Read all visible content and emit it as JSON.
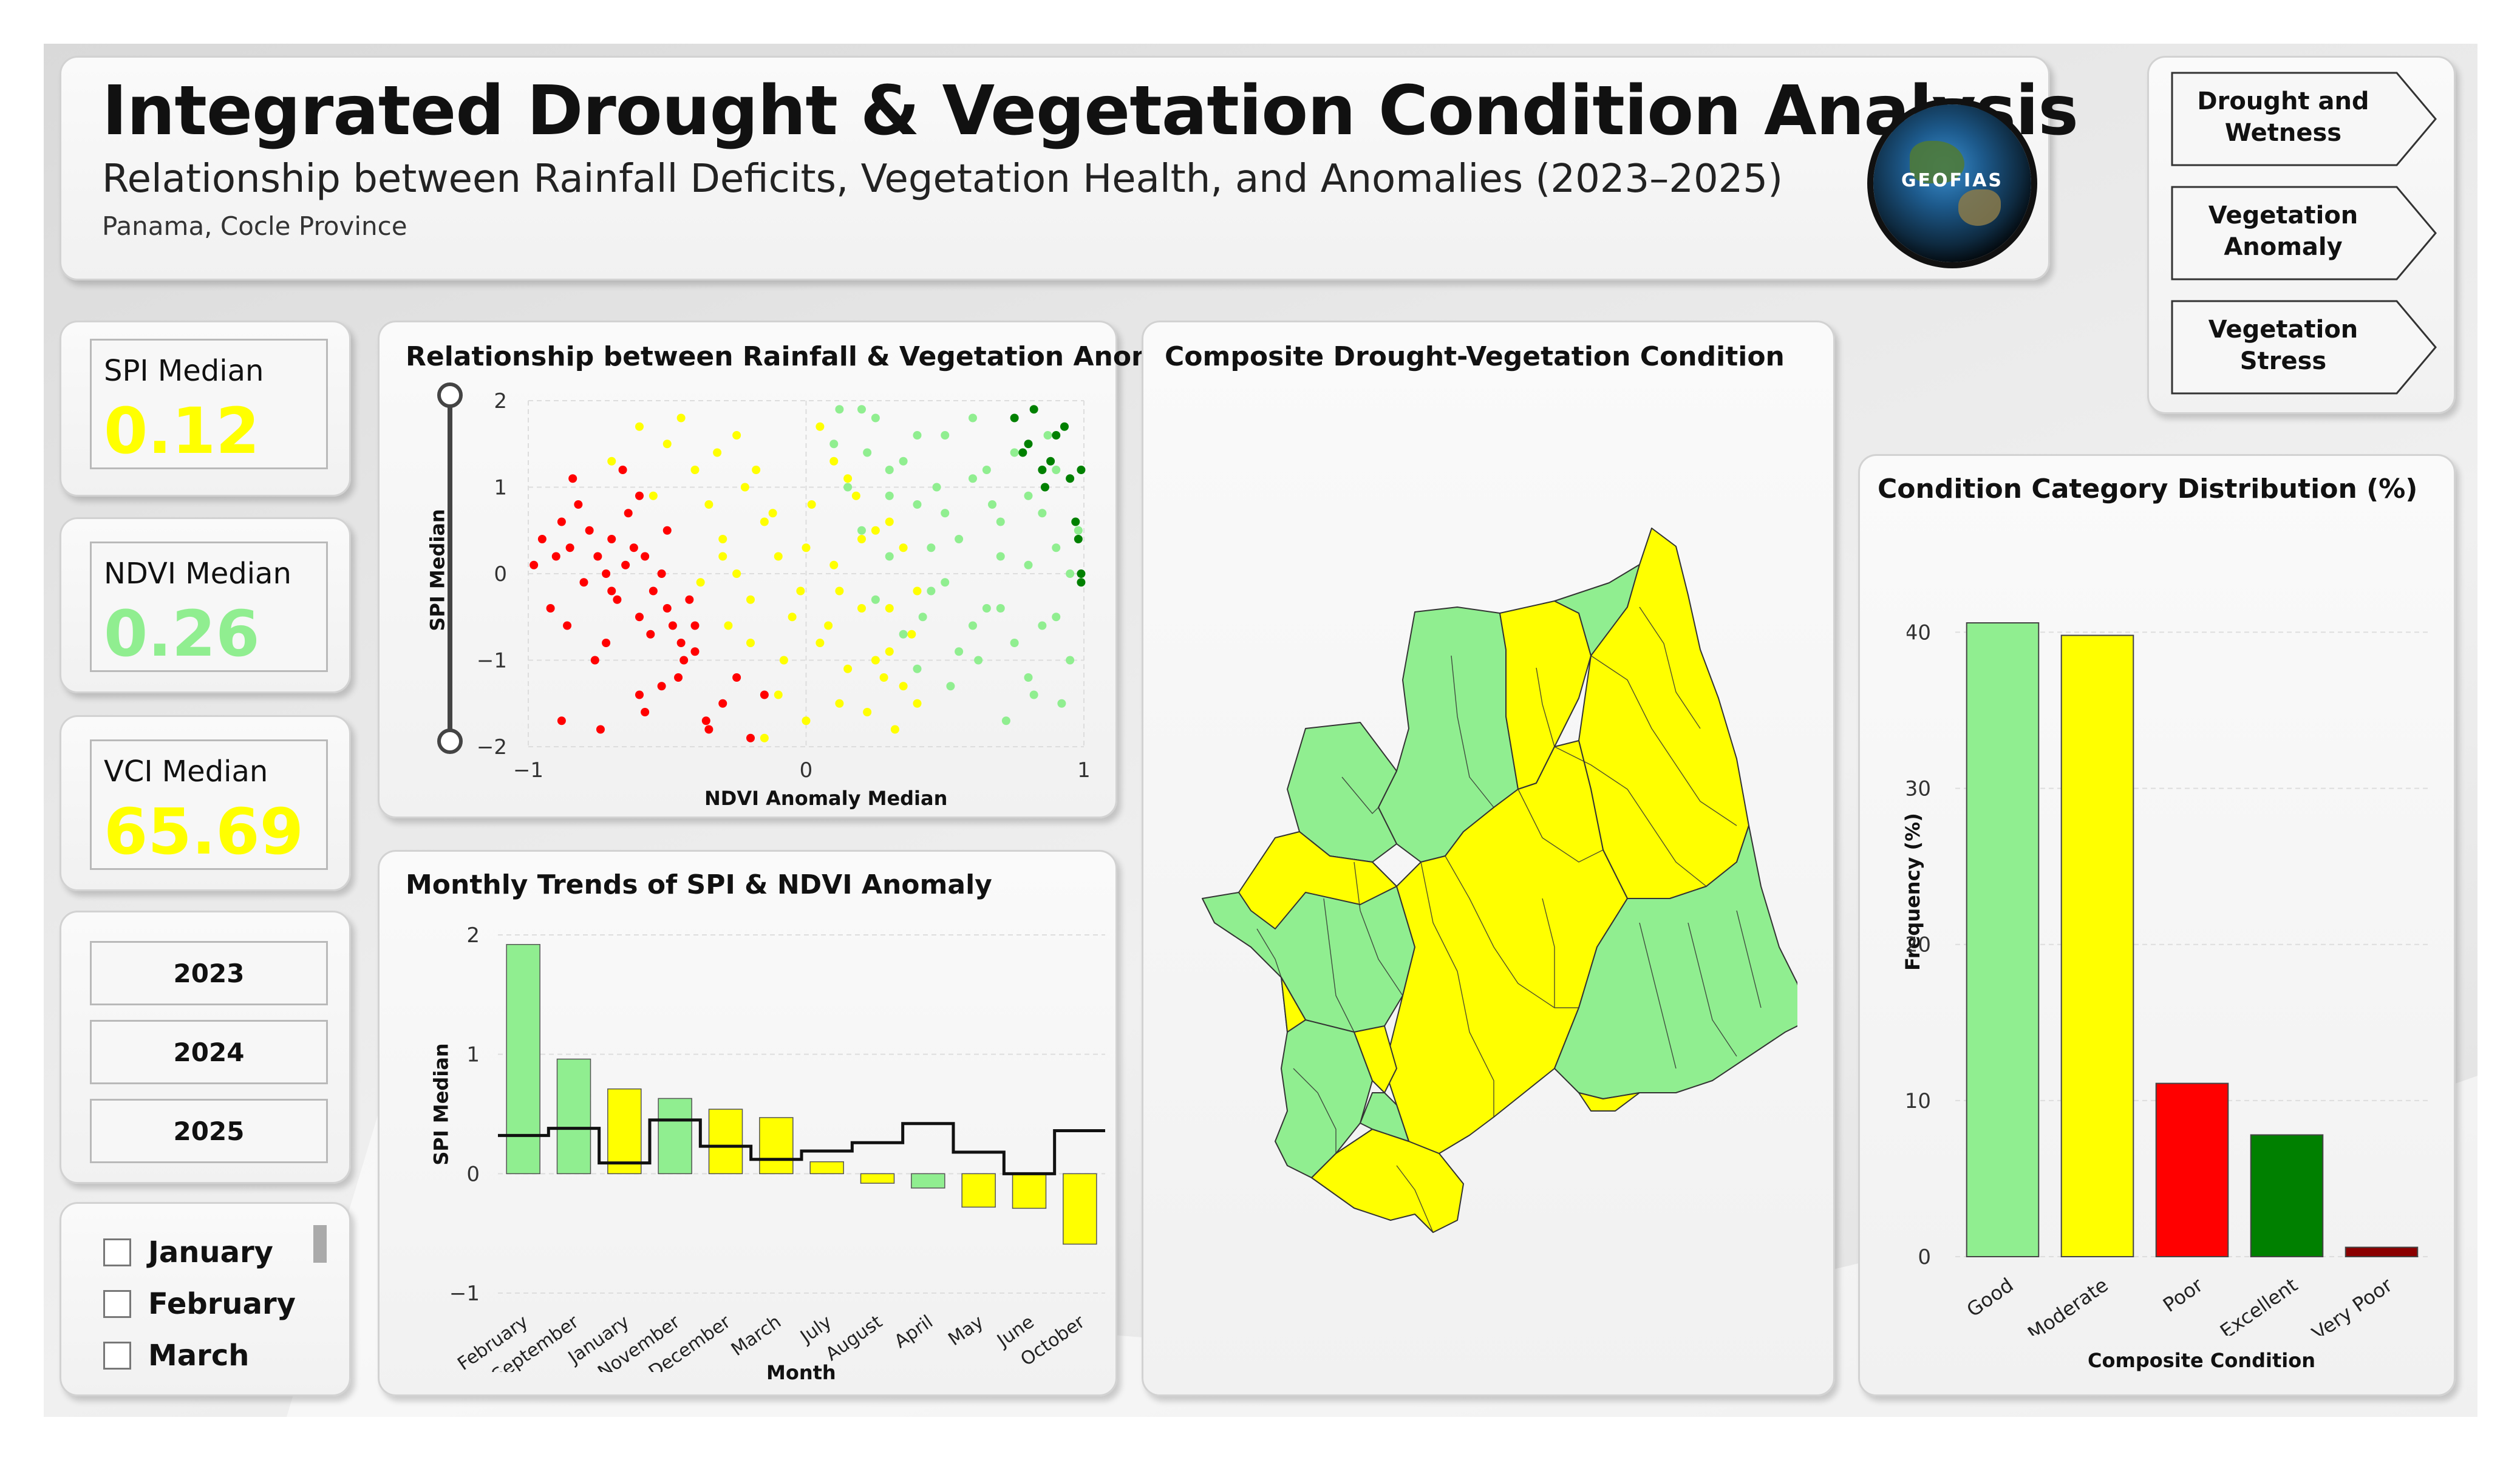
{
  "header": {
    "title": "Integrated Drought & Vegetation Condition Analysis",
    "subtitle": "Relationship between Rainfall Deficits, Vegetation Health, and Anomalies (2023–2025)",
    "location": "Panama, Cocle Province",
    "logo_text": "GEOFIAS"
  },
  "nav": {
    "buttons": [
      "Drought and Wetness",
      "Vegetation Anomaly",
      "Vegetation Stress"
    ]
  },
  "kpis": [
    {
      "label": "SPI Median",
      "value": "0.12",
      "color": "#ffff00"
    },
    {
      "label": "NDVI Median",
      "value": "0.26",
      "color": "#90ee90"
    },
    {
      "label": "VCI Median",
      "value": "65.69",
      "color": "#ffff00"
    }
  ],
  "years": [
    "2023",
    "2024",
    "2025"
  ],
  "months": [
    "January",
    "February",
    "March"
  ],
  "scatter": {
    "title": "Relationship between Rainfall & Vegetation Anomalies",
    "xlabel": "NDVI Anomaly Median",
    "ylabel": "SPI Median"
  },
  "trends": {
    "title": "Monthly Trends of SPI & NDVI Anomaly",
    "xlabel": "Month",
    "ylabel": "SPI Median"
  },
  "map": {
    "title": "Composite Drought-Vegetation Condition"
  },
  "distribution": {
    "title": "Condition Category Distribution (%)",
    "xlabel": "Composite Condition",
    "ylabel": "Frequency (%)"
  },
  "colors": {
    "good": "#90ee90",
    "moderate": "#ffff00",
    "poor": "#ff0000",
    "excellent": "#008000",
    "very_poor": "#8b0000"
  },
  "chart_data": [
    {
      "type": "scatter",
      "title": "Relationship between Rainfall & Vegetation Anomalies",
      "xlabel": "NDVI Anomaly Median",
      "ylabel": "SPI Median",
      "xlim": [
        -1,
        1
      ],
      "ylim": [
        -2,
        2
      ],
      "xticks": [
        -1,
        0,
        1
      ],
      "yticks": [
        -2,
        -1,
        0,
        1,
        2
      ],
      "series": [
        {
          "color": "#ff0000",
          "x": [
            -0.95,
            -0.9,
            -0.88,
            -0.85,
            -0.8,
            -0.78,
            -0.75,
            -0.72,
            -0.7,
            -0.68,
            -0.65,
            -0.62,
            -0.6,
            -0.58,
            -0.55,
            -0.52,
            -0.5,
            -0.48,
            -0.45,
            -0.42,
            -0.4,
            -0.92,
            -0.86,
            -0.82,
            -0.76,
            -0.7,
            -0.64,
            -0.6,
            -0.56,
            -0.5,
            -0.46,
            -0.4,
            -0.36,
            -0.98,
            -0.84,
            -0.74,
            -0.66,
            -0.58,
            -0.52,
            -0.44,
            -0.3,
            -0.2,
            -0.15,
            -0.6,
            -0.72,
            -0.88,
            -0.35,
            -0.25
          ],
          "y": [
            0.4,
            0.2,
            0.6,
            0.3,
            -0.1,
            0.5,
            0.2,
            0.0,
            0.4,
            -0.3,
            0.1,
            0.3,
            -0.5,
            0.2,
            -0.2,
            0.0,
            -0.4,
            -0.6,
            -0.8,
            -0.3,
            -0.9,
            -0.4,
            -0.6,
            0.8,
            -1.0,
            -0.2,
            0.7,
            -1.4,
            -0.7,
            0.5,
            -1.2,
            -0.6,
            -1.7,
            0.1,
            1.1,
            -1.8,
            1.2,
            -1.6,
            -1.3,
            -1.0,
            -1.5,
            -1.9,
            -1.4,
            0.9,
            -0.8,
            -1.7,
            -1.8,
            -1.2
          ]
        },
        {
          "color": "#ffff00",
          "x": [
            -0.5,
            -0.4,
            -0.35,
            -0.3,
            -0.25,
            -0.2,
            -0.15,
            -0.1,
            -0.05,
            0.0,
            0.05,
            0.1,
            0.15,
            0.2,
            0.25,
            0.3,
            0.35,
            0.4,
            -0.45,
            -0.32,
            -0.22,
            -0.12,
            -0.02,
            0.08,
            0.18,
            0.28,
            0.38,
            -0.38,
            -0.28,
            -0.18,
            -0.08,
            0.02,
            0.12,
            0.22,
            0.32,
            -0.3,
            -0.1,
            0.1,
            0.3,
            -0.2,
            0.0,
            0.2,
            0.4,
            -0.6,
            -0.7,
            -0.55,
            -0.25,
            0.05,
            0.15,
            0.25,
            0.35,
            -0.15,
            0.12,
            0.3
          ],
          "y": [
            1.5,
            1.2,
            0.8,
            0.4,
            0.0,
            -0.3,
            0.6,
            0.2,
            -0.5,
            0.3,
            -0.8,
            0.1,
            -1.1,
            -0.4,
            0.5,
            -0.9,
            -1.3,
            -0.2,
            1.8,
            1.4,
            1.0,
            0.7,
            -0.2,
            -0.6,
            0.9,
            -1.2,
            -0.7,
            -0.1,
            -0.6,
            1.2,
            -1.0,
            0.8,
            -1.5,
            -1.6,
            -1.8,
            0.2,
            -1.4,
            1.3,
            -0.4,
            -0.8,
            -1.7,
            0.4,
            -1.5,
            1.7,
            1.3,
            0.9,
            1.6,
            1.7,
            1.1,
            -1.0,
            0.3,
            -1.9,
            -0.2,
            0.6
          ]
        },
        {
          "color": "#90ee90",
          "x": [
            0.1,
            0.15,
            0.2,
            0.25,
            0.3,
            0.35,
            0.4,
            0.45,
            0.5,
            0.55,
            0.6,
            0.65,
            0.7,
            0.75,
            0.8,
            0.85,
            0.9,
            0.95,
            0.2,
            0.3,
            0.4,
            0.5,
            0.6,
            0.7,
            0.8,
            0.9,
            0.25,
            0.35,
            0.45,
            0.55,
            0.65,
            0.75,
            0.85,
            0.95,
            0.3,
            0.5,
            0.7,
            0.9,
            0.4,
            0.6,
            0.8,
            0.98,
            0.12,
            0.22,
            0.42,
            0.62,
            0.82,
            0.52,
            0.72,
            0.92,
            0.47,
            0.67,
            0.87
          ],
          "y": [
            1.5,
            1.0,
            0.5,
            1.8,
            0.2,
            1.3,
            0.8,
            -0.2,
            1.6,
            0.4,
            1.1,
            -0.4,
            0.6,
            1.4,
            0.1,
            -0.6,
            0.3,
            -1.0,
            1.9,
            0.9,
            1.6,
            -0.1,
            1.8,
            0.2,
            0.9,
            -0.5,
            -0.3,
            -0.7,
            0.3,
            -0.9,
            1.2,
            -0.8,
            0.7,
            0.0,
            1.2,
            0.7,
            -0.4,
            1.2,
            -1.1,
            -0.6,
            -1.2,
            0.5,
            1.9,
            1.4,
            -0.5,
            -1.0,
            -1.4,
            -1.3,
            -1.7,
            -1.5,
            1.0,
            0.8,
            1.6
          ]
        },
        {
          "color": "#008000",
          "x": [
            0.75,
            0.8,
            0.85,
            0.9,
            0.95,
            0.98,
            0.99,
            0.82,
            0.88,
            0.93,
            0.97,
            0.78,
            0.86,
            0.99,
            0.99
          ],
          "y": [
            1.8,
            1.5,
            1.2,
            1.6,
            1.1,
            0.4,
            0.0,
            1.9,
            1.3,
            1.7,
            0.6,
            1.4,
            1.0,
            1.2,
            -0.1
          ]
        }
      ]
    },
    {
      "type": "bar",
      "title": "Monthly Trends of SPI & NDVI Anomaly",
      "xlabel": "Month",
      "ylabel": "SPI Median",
      "ylim": [
        -1,
        2
      ],
      "yticks": [
        -1,
        0,
        1,
        2
      ],
      "categories": [
        "February",
        "September",
        "January",
        "November",
        "December",
        "March",
        "July",
        "August",
        "April",
        "May",
        "June",
        "October"
      ],
      "values": [
        1.92,
        0.96,
        0.71,
        0.63,
        0.54,
        0.47,
        0.1,
        -0.08,
        -0.12,
        -0.28,
        -0.29,
        -0.59
      ],
      "bar_colors": [
        "#90ee90",
        "#90ee90",
        "#ffff00",
        "#90ee90",
        "#ffff00",
        "#ffff00",
        "#ffff00",
        "#ffff00",
        "#90ee90",
        "#ffff00",
        "#ffff00",
        "#ffff00"
      ],
      "line_values": [
        0.32,
        0.38,
        0.09,
        0.45,
        0.23,
        0.12,
        0.19,
        0.26,
        0.42,
        0.18,
        0.0,
        0.36
      ]
    },
    {
      "type": "bar",
      "title": "Condition Category Distribution (%)",
      "xlabel": "Composite Condition",
      "ylabel": "Frequency (%)",
      "ylim": [
        0,
        42
      ],
      "yticks": [
        0,
        10,
        20,
        30,
        40
      ],
      "categories": [
        "Good",
        "Moderate",
        "Poor",
        "Excellent",
        "Very Poor"
      ],
      "values": [
        40.6,
        39.8,
        11.1,
        7.8,
        0.6
      ],
      "bar_colors": [
        "#90ee90",
        "#ffff00",
        "#ff0000",
        "#008000",
        "#8b0000"
      ]
    }
  ]
}
